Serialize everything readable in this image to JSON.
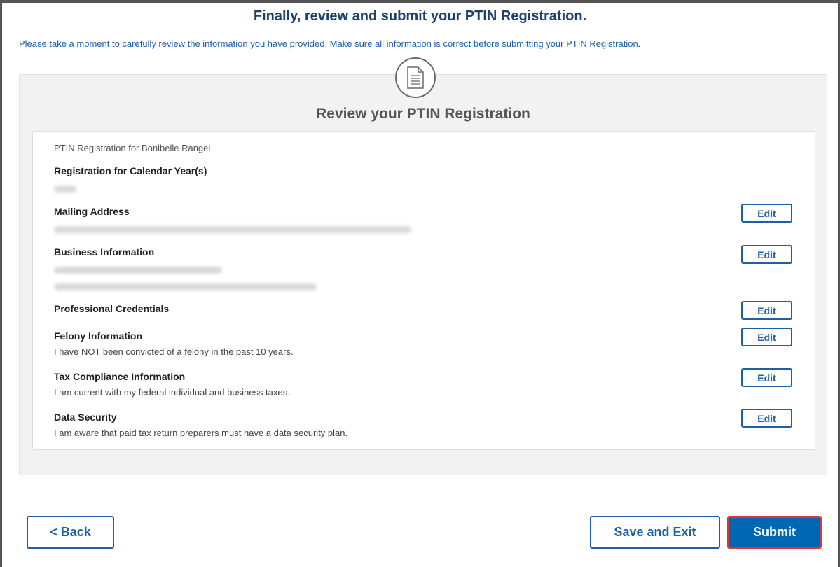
{
  "header": {
    "title": "Finally, review and submit your PTIN Registration.",
    "intro": "Please take a moment to carefully review the information you have provided. Make sure all information is correct before submitting your PTIN Registration."
  },
  "panel": {
    "icon": "document-icon",
    "heading": "Review your PTIN Registration"
  },
  "card": {
    "subtitle": "PTIN Registration for Bonibelle Rangel",
    "sections": {
      "calendar_years": {
        "title": "Registration for Calendar Year(s)"
      },
      "mailing_address": {
        "title": "Mailing Address",
        "edit_label": "Edit"
      },
      "business_information": {
        "title": "Business Information",
        "edit_label": "Edit"
      },
      "professional_credentials": {
        "title": "Professional Credentials",
        "edit_label": "Edit"
      },
      "felony_information": {
        "title": "Felony Information",
        "text": "I have NOT been convicted of a felony in the past 10 years.",
        "edit_label": "Edit"
      },
      "tax_compliance": {
        "title": "Tax Compliance Information",
        "text": "I am current with my federal individual and business taxes.",
        "edit_label": "Edit"
      },
      "data_security": {
        "title": "Data Security",
        "text": "I am aware that paid tax return preparers must have a data security plan.",
        "edit_label": "Edit"
      }
    }
  },
  "footer": {
    "back_label": "< Back",
    "save_exit_label": "Save and Exit",
    "submit_label": "Submit"
  },
  "colors": {
    "title": "#1d3f6e",
    "link_blue": "#1f5fa5",
    "submit_fill": "#0068b3",
    "submit_highlight": "#d9383a"
  }
}
